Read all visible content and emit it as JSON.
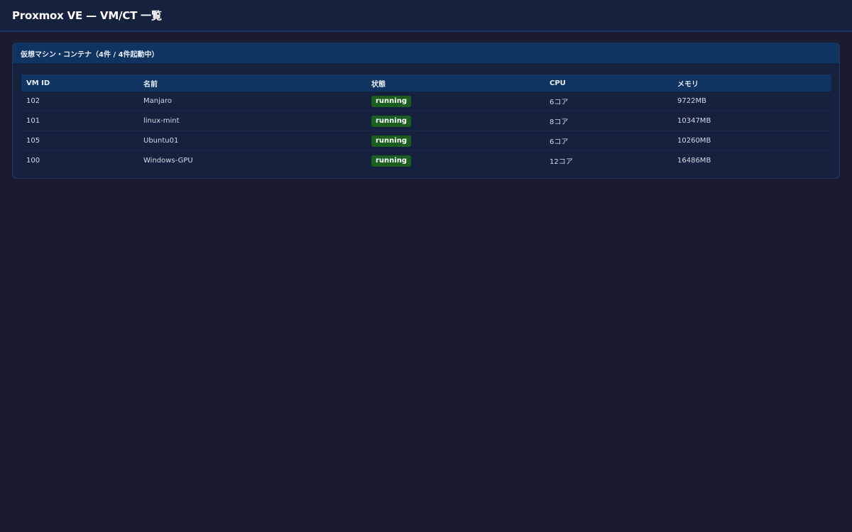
{
  "header": {
    "title": "Proxmox VE — VM/CT 一覧"
  },
  "panel": {
    "title": "仮想マシン・コンテナ（4件 / 4件起動中）"
  },
  "table": {
    "columns": [
      "VM ID",
      "名前",
      "状態",
      "CPU",
      "メモリ"
    ],
    "rows": [
      {
        "vmid": "102",
        "name": "Manjaro",
        "status": "running",
        "cpu": "6コア",
        "memory": "9722MB"
      },
      {
        "vmid": "101",
        "name": "linux-mint",
        "status": "running",
        "cpu": "8コア",
        "memory": "10347MB"
      },
      {
        "vmid": "105",
        "name": "Ubuntu01",
        "status": "running",
        "cpu": "6コア",
        "memory": "10260MB"
      },
      {
        "vmid": "100",
        "name": "Windows-GPU",
        "status": "running",
        "cpu": "12コア",
        "memory": "16486MB"
      }
    ]
  },
  "colors": {
    "background": "#1a1b2e",
    "topbar": "#16213e",
    "panel_header": "#0f3460",
    "status_running": "#1b5e20"
  }
}
